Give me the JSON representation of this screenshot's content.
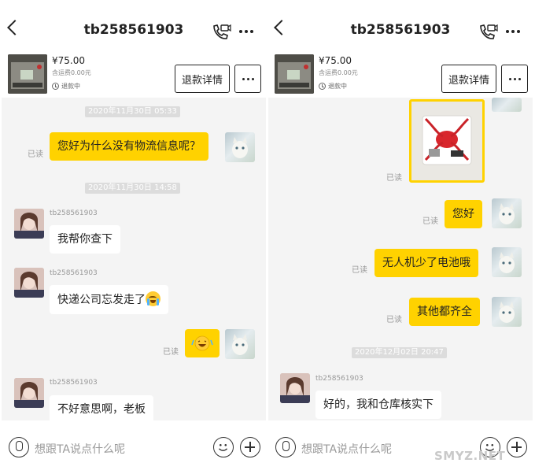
{
  "chat": {
    "title": "tb258561903",
    "order": {
      "price": "¥75.00",
      "shipping": "含运费0.00元",
      "status": "退款中",
      "refund_button": "退款详情"
    },
    "input_placeholder": "想跟TA说点什么呢",
    "read_label": "已读",
    "sender_name": "tb258561903"
  },
  "left": {
    "ts1": "2020年11月30日 05:33",
    "msg1": "您好为什么没有物流信息呢？",
    "ts2": "2020年11月30日 14:58",
    "msg2": "我帮你查下",
    "msg3": "快递公司忘发走了",
    "msg5": "不好意思啊，老板"
  },
  "right": {
    "msg1": "您好",
    "msg2": "无人机少了电池哦",
    "msg3": "其他都齐全",
    "ts": "2020年12月02日 20:47",
    "msg4": "好的，我和仓库核实下"
  },
  "watermark": "SMYZ.NET",
  "icons": [
    "back-icon",
    "video-call-icon",
    "more-icon",
    "clock-icon",
    "mic-icon",
    "emoji-icon",
    "plus-icon",
    "cry-emoji-icon",
    "laugh-emoji-icon"
  ]
}
